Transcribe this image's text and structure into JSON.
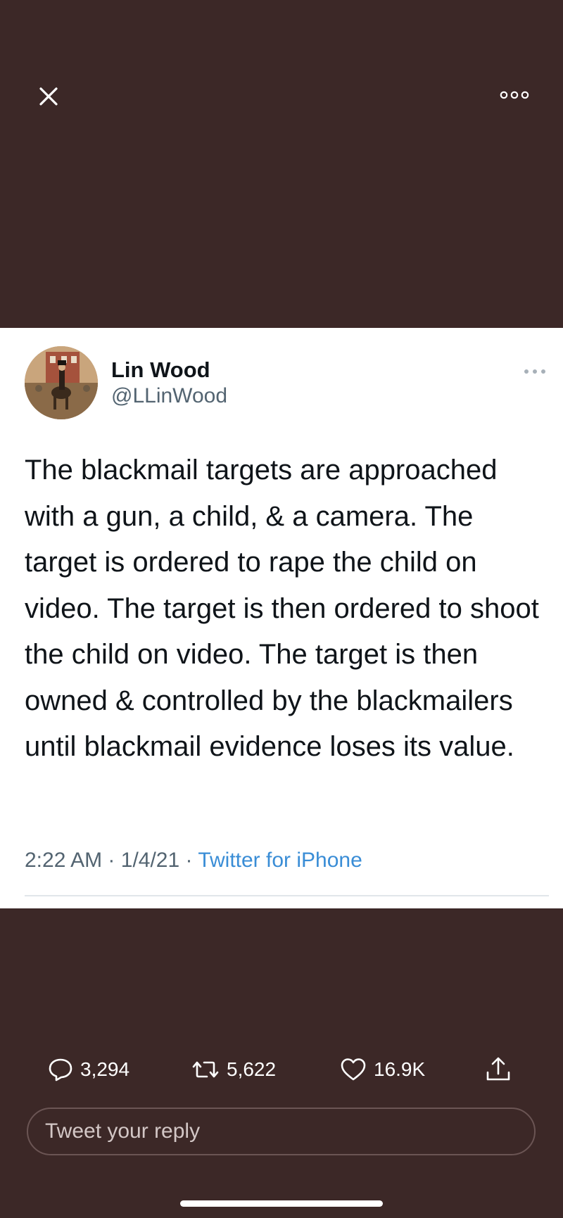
{
  "top_bar": {
    "close_icon": "close-icon",
    "more_icon": "more-options-icon"
  },
  "tweet": {
    "author_name": "Lin Wood",
    "author_handle": "@LLinWood",
    "text": "The blackmail targets are approached with a gun, a child, & a camera. The target is ordered to rape the child on video. The target is then ordered to shoot the child on video. The target is then owned & controlled by the blackmailers until blackmail evidence loses its value.",
    "time": "2:22 AM",
    "separator": "·",
    "date": "1/4/21",
    "source": "Twitter for iPhone"
  },
  "actions": {
    "reply_count": "3,294",
    "retweet_count": "5,622",
    "like_count": "16.9K",
    "reply_icon": "reply-icon",
    "retweet_icon": "retweet-icon",
    "like_icon": "heart-icon",
    "share_icon": "share-icon"
  },
  "reply_input": {
    "placeholder": "Tweet your reply"
  },
  "colors": {
    "background": "#3c2827",
    "card": "#ffffff",
    "link": "#3a8dd6",
    "secondary_text": "#536471"
  }
}
